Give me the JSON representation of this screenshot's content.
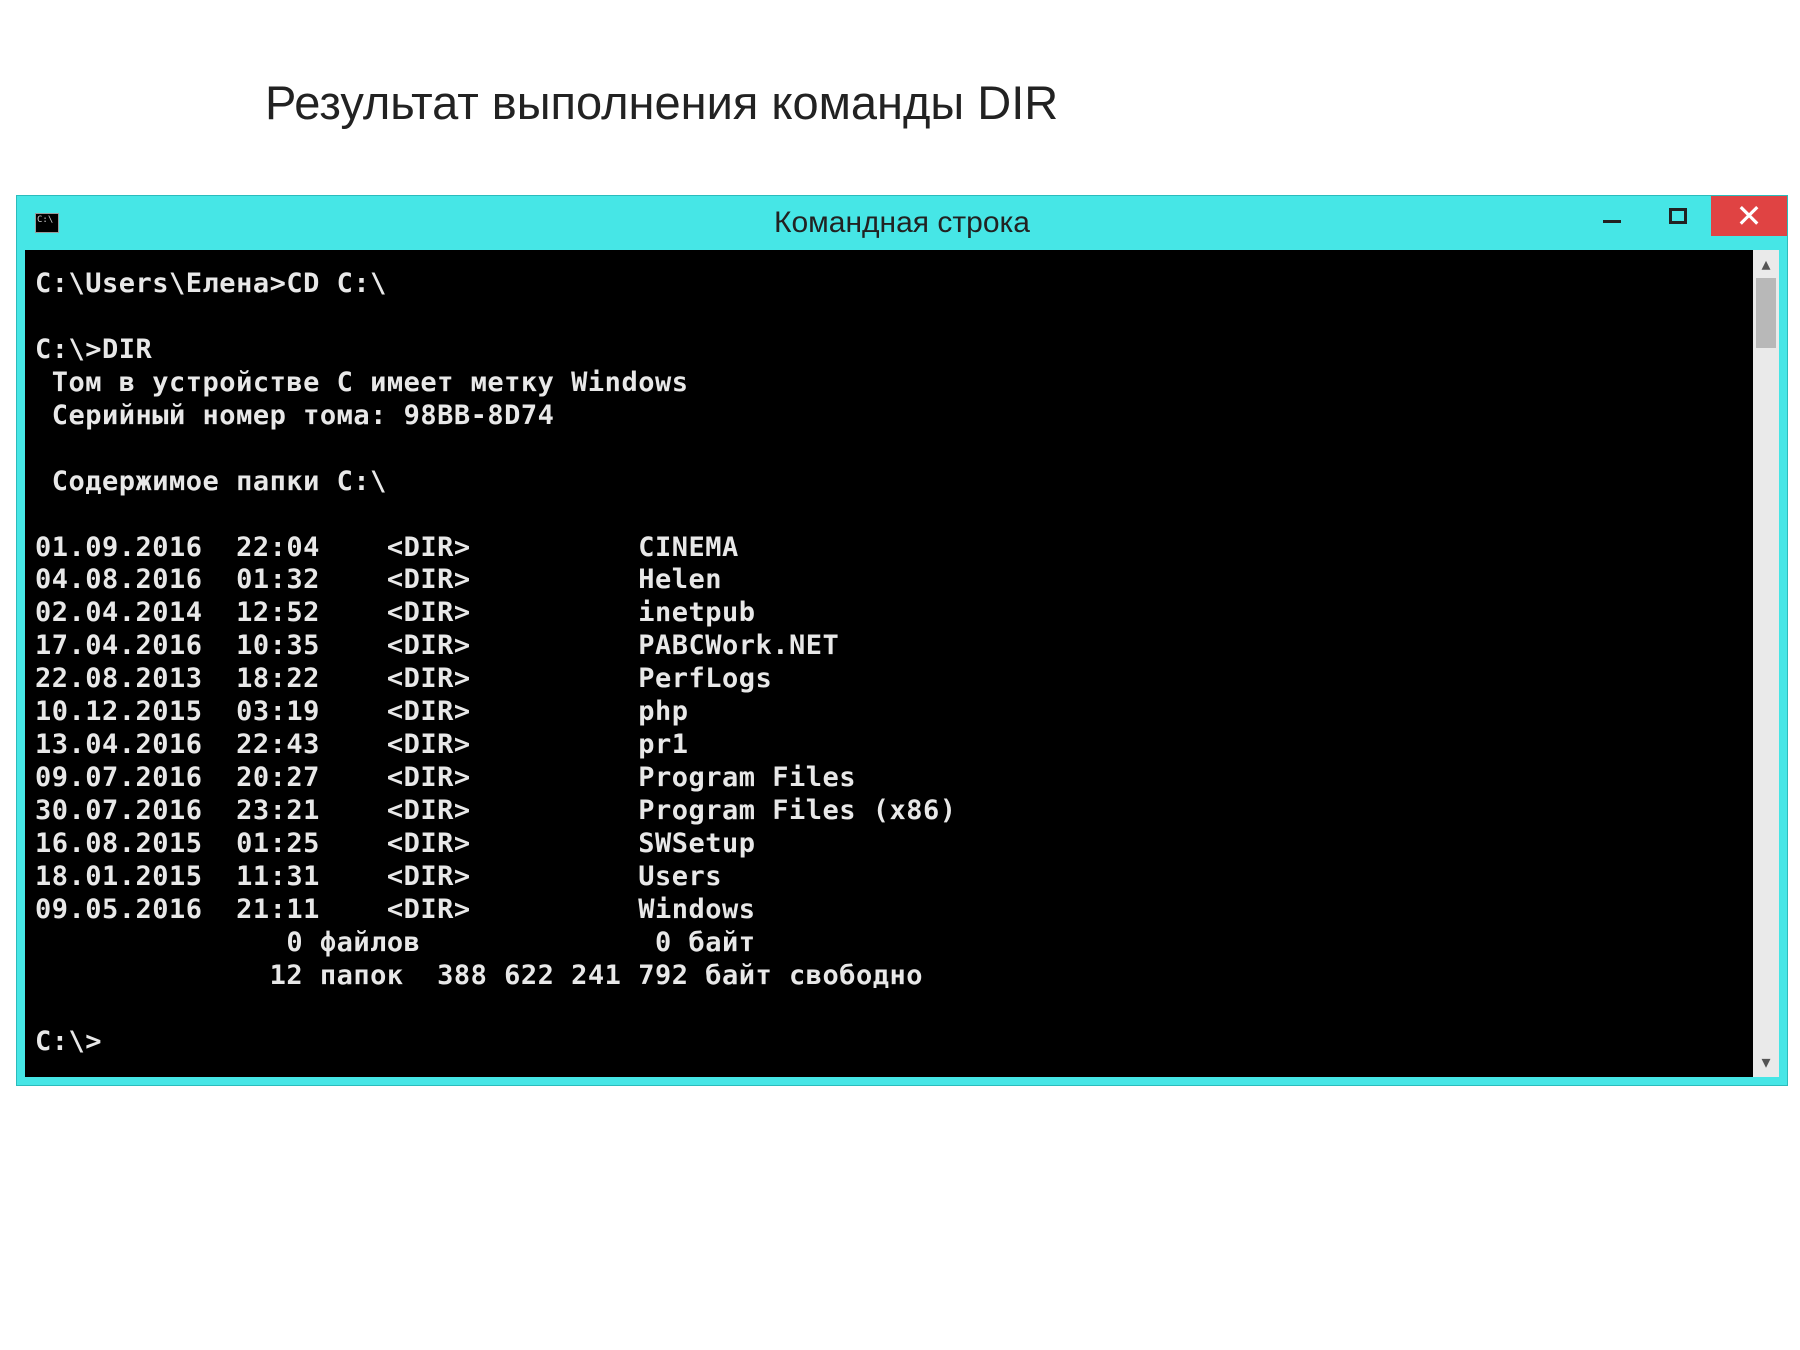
{
  "page": {
    "heading": "Результат выполнения команды DIR"
  },
  "window": {
    "title": "Командная строка",
    "icon_name": "cmd-icon",
    "controls": {
      "minimize": "–",
      "maximize": "",
      "close": "✕"
    }
  },
  "terminal": {
    "prompt1": "C:\\Users\\Елена>CD C:\\",
    "blank1": "",
    "prompt2": "C:\\>DIR",
    "vol_line": " Том в устройстве C имеет метку Windows",
    "serial_line": " Серийный номер тома: 98BB-8D74",
    "blank2": "",
    "content_header": " Содержимое папки C:\\",
    "blank3": "",
    "entries": [
      {
        "date": "01.09.2016",
        "time": "22:04",
        "type": "<DIR>",
        "name": "CINEMA"
      },
      {
        "date": "04.08.2016",
        "time": "01:32",
        "type": "<DIR>",
        "name": "Helen"
      },
      {
        "date": "02.04.2014",
        "time": "12:52",
        "type": "<DIR>",
        "name": "inetpub"
      },
      {
        "date": "17.04.2016",
        "time": "10:35",
        "type": "<DIR>",
        "name": "PABCWork.NET"
      },
      {
        "date": "22.08.2013",
        "time": "18:22",
        "type": "<DIR>",
        "name": "PerfLogs"
      },
      {
        "date": "10.12.2015",
        "time": "03:19",
        "type": "<DIR>",
        "name": "php"
      },
      {
        "date": "13.04.2016",
        "time": "22:43",
        "type": "<DIR>",
        "name": "pr1"
      },
      {
        "date": "09.07.2016",
        "time": "20:27",
        "type": "<DIR>",
        "name": "Program Files"
      },
      {
        "date": "30.07.2016",
        "time": "23:21",
        "type": "<DIR>",
        "name": "Program Files (x86)"
      },
      {
        "date": "16.08.2015",
        "time": "01:25",
        "type": "<DIR>",
        "name": "SWSetup"
      },
      {
        "date": "18.01.2015",
        "time": "11:31",
        "type": "<DIR>",
        "name": "Users"
      },
      {
        "date": "09.05.2016",
        "time": "21:11",
        "type": "<DIR>",
        "name": "Windows"
      }
    ],
    "summary_files": "               0 файлов              0 байт",
    "summary_dirs": "              12 папок  388 622 241 792 байт свободно",
    "blank4": "",
    "prompt3": "C:\\>"
  }
}
